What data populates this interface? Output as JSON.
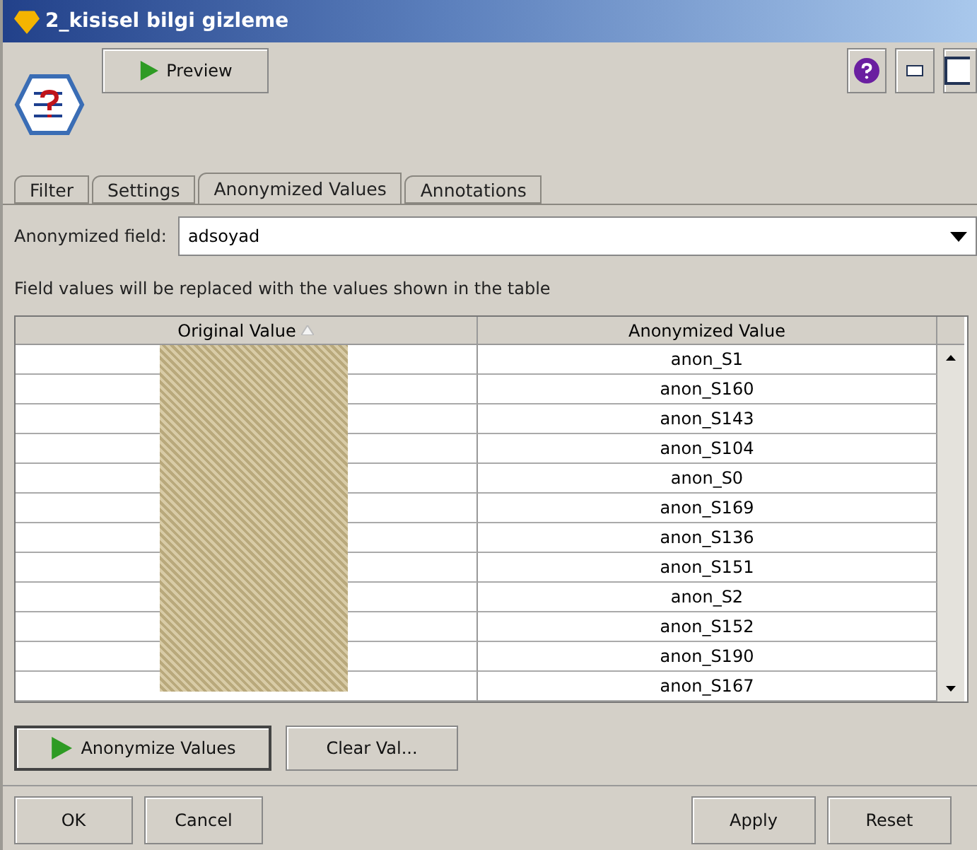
{
  "window": {
    "title": "2_kisisel bilgi gizleme"
  },
  "toolbar": {
    "preview_button": "Preview"
  },
  "tabs": [
    {
      "label": "Filter",
      "selected": false
    },
    {
      "label": "Settings",
      "selected": false
    },
    {
      "label": "Anonymized Values",
      "selected": true
    },
    {
      "label": "Annotations",
      "selected": false
    }
  ],
  "anonymized_field": {
    "label": "Anonymized field:",
    "value": "adsoyad"
  },
  "description": "Field values will be replaced with the values shown in the table",
  "table": {
    "columns": [
      {
        "label": "Original Value",
        "sorted": true
      },
      {
        "label": "Anonymized Value",
        "sorted": false
      }
    ],
    "rows": [
      {
        "anonymized": "anon_S1"
      },
      {
        "anonymized": "anon_S160"
      },
      {
        "anonymized": "anon_S143"
      },
      {
        "anonymized": "anon_S104"
      },
      {
        "anonymized": "anon_S0"
      },
      {
        "anonymized": "anon_S169"
      },
      {
        "anonymized": "anon_S136"
      },
      {
        "anonymized": "anon_S151"
      },
      {
        "anonymized": "anon_S2"
      },
      {
        "anonymized": "anon_S152"
      },
      {
        "anonymized": "anon_S190"
      },
      {
        "anonymized": "anon_S167"
      }
    ]
  },
  "actions": [
    {
      "label": "Anonymize Values",
      "kind": "play"
    },
    {
      "label": "Clear Val...",
      "kind": "plain"
    }
  ],
  "footer": {
    "left": [
      "OK",
      "Cancel"
    ],
    "right": [
      "Apply",
      "Reset"
    ]
  }
}
